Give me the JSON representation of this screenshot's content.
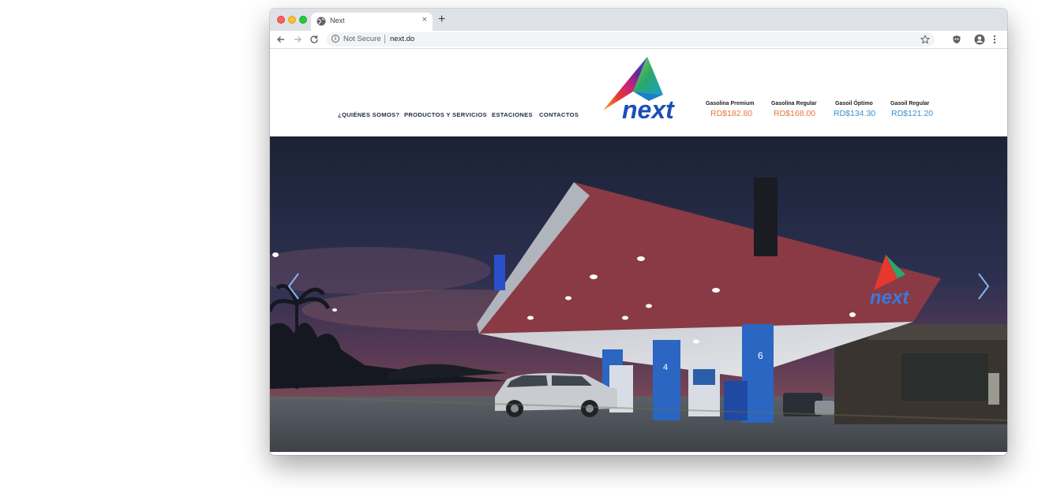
{
  "browser": {
    "tab_title": "Next",
    "tab_close": "×",
    "new_tab": "+",
    "security_label": "Not Secure",
    "url": "next.do"
  },
  "site": {
    "nav": [
      {
        "label": "¿QUIÉNES SOMOS?"
      },
      {
        "label": "PRODUCTOS Y SERVICIOS"
      },
      {
        "label": "ESTACIONES"
      },
      {
        "label": "CONTACTOS"
      }
    ],
    "logo_text": "next",
    "prices": [
      {
        "name": "Gasolina Premium",
        "price": "RD$182.80",
        "color": "#e8763a"
      },
      {
        "name": "Gasolina Regular",
        "price": "RD$168.00",
        "color": "#e8763a"
      },
      {
        "name": "Gasoil Óptimo",
        "price": "RD$134.30",
        "color": "#3a8fcf"
      },
      {
        "name": "Gasoil Regular",
        "price": "RD$121.20",
        "color": "#3a8fcf"
      }
    ],
    "hero": {
      "station_sign_text": "next",
      "pump_numbers": [
        "4",
        "6"
      ]
    }
  },
  "colors": {
    "brand_blue": "#1b4fb8",
    "accent_orange": "#e8763a",
    "accent_blue": "#3a8fcf"
  },
  "icons": {
    "back": "arrow-left-icon",
    "forward": "arrow-right-icon",
    "reload": "reload-icon",
    "bookmark": "star-icon",
    "extension": "shield-icon",
    "profile": "profile-icon",
    "menu": "more-vert-icon",
    "slider_prev": "chevron-left-icon",
    "slider_next": "chevron-right-icon"
  }
}
